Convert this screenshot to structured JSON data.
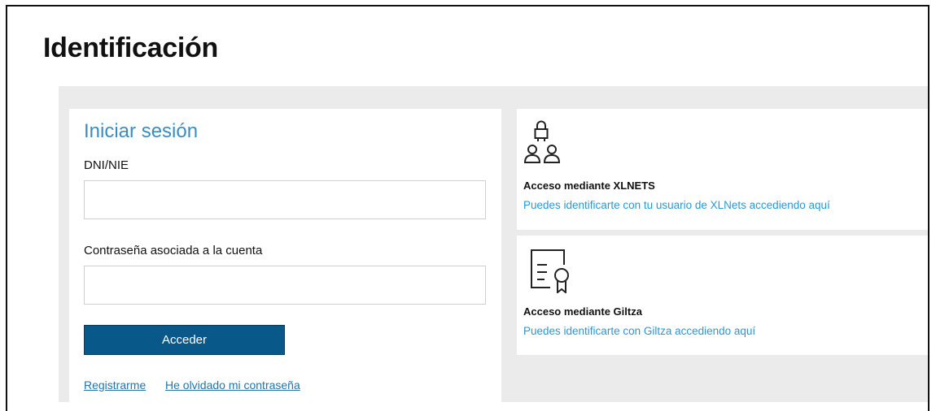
{
  "page": {
    "title": "Identificación"
  },
  "login": {
    "title": "Iniciar sesión",
    "dni_label": "DNI/NIE",
    "dni_value": "",
    "password_label": "Contraseña asociada a la cuenta",
    "password_value": "",
    "submit_label": "Acceder",
    "register_link": "Registrarme",
    "forgot_link": "He olvidado mi contraseña"
  },
  "options": {
    "xlnets": {
      "icon": "users-network-icon",
      "title": "Acceso mediante XLNETS",
      "link": "Puedes identificarte con tu usuario de XLNets accediendo aquí"
    },
    "giltza": {
      "icon": "certificate-icon",
      "title": "Acceso mediante Giltza",
      "link": "Puedes identificarte con Giltza accediendo aquí"
    }
  },
  "colors": {
    "heading_blue": "#3a8dc0",
    "button_blue": "#09588a",
    "link_blue": "#2a97d3",
    "panel_background": "#ebebeb"
  }
}
